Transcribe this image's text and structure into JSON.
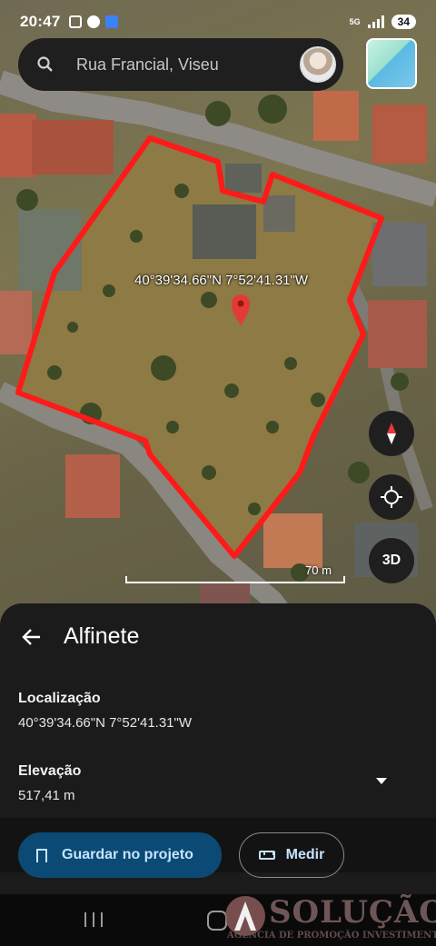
{
  "status_bar": {
    "time": "20:47",
    "network": "5G",
    "battery": "34"
  },
  "search": {
    "query": "Rua Francial, Viseu"
  },
  "map": {
    "pin_coordinates": "40°39'34.66\"N 7°52'41.31\"W",
    "scale": "70 m",
    "button_3d": "3D",
    "boundary_color": "#ff1a1a",
    "pin_color": "#e53935"
  },
  "sheet": {
    "title": "Alfinete",
    "location_label": "Localização",
    "location_value": "40°39'34.66\"N 7°52'41.31\"W",
    "elevation_label": "Elevação",
    "elevation_value": "517,41 m",
    "save_label": "Guardar no projeto",
    "measure_label": "Medir"
  },
  "watermark": {
    "name": "SOLUÇÃO",
    "tagline": "AGÊNCIA DE PROMOÇÃO INVESTIMENTOS"
  },
  "icons": [
    "search-icon",
    "layers-icon",
    "compass-icon",
    "my-location-icon",
    "back-arrow-icon",
    "bookmark-icon",
    "ruler-icon",
    "chevron-down-icon",
    "map-pin-icon"
  ]
}
